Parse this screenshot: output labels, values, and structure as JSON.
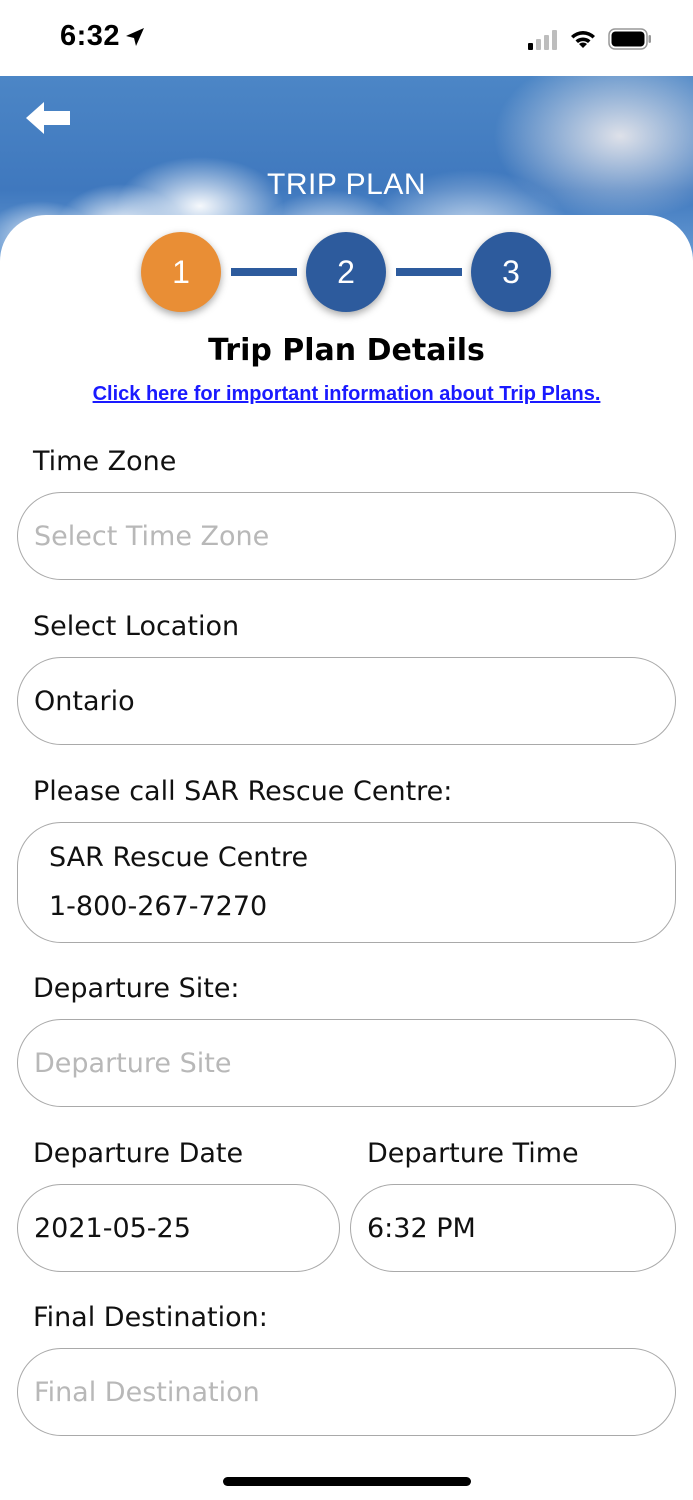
{
  "status_bar": {
    "time": "6:32",
    "icons": [
      "location-arrow-icon",
      "cellular-signal-icon",
      "wifi-icon",
      "battery-icon"
    ]
  },
  "header": {
    "title": "TRIP PLAN",
    "back_icon": "back-arrow-icon"
  },
  "stepper": {
    "steps": [
      "1",
      "2",
      "3"
    ],
    "active_step": 1,
    "active_color": "#e98e35",
    "inactive_color": "#2d5b9d"
  },
  "section": {
    "title": "Trip Plan Details",
    "info_link": "Click here for important information about Trip Plans."
  },
  "form": {
    "time_zone": {
      "label": "Time Zone",
      "placeholder": "Select Time Zone",
      "value": ""
    },
    "location": {
      "label": "Select Location",
      "value": "Ontario"
    },
    "sar": {
      "label": "Please call SAR Rescue Centre:",
      "name": "SAR Rescue Centre",
      "phone": "1-800-267-7270"
    },
    "departure_site": {
      "label": "Departure Site:",
      "placeholder": "Departure Site",
      "value": ""
    },
    "departure_date": {
      "label": "Departure Date",
      "value": "2021-05-25"
    },
    "departure_time": {
      "label": "Departure Time",
      "value": "6:32 PM"
    },
    "final_destination": {
      "label": "Final Destination:",
      "placeholder": "Final Destination",
      "value": ""
    }
  },
  "colors": {
    "link": "#1a1aff",
    "field_border": "#a9a9a9",
    "placeholder": "#b8b8b8"
  }
}
